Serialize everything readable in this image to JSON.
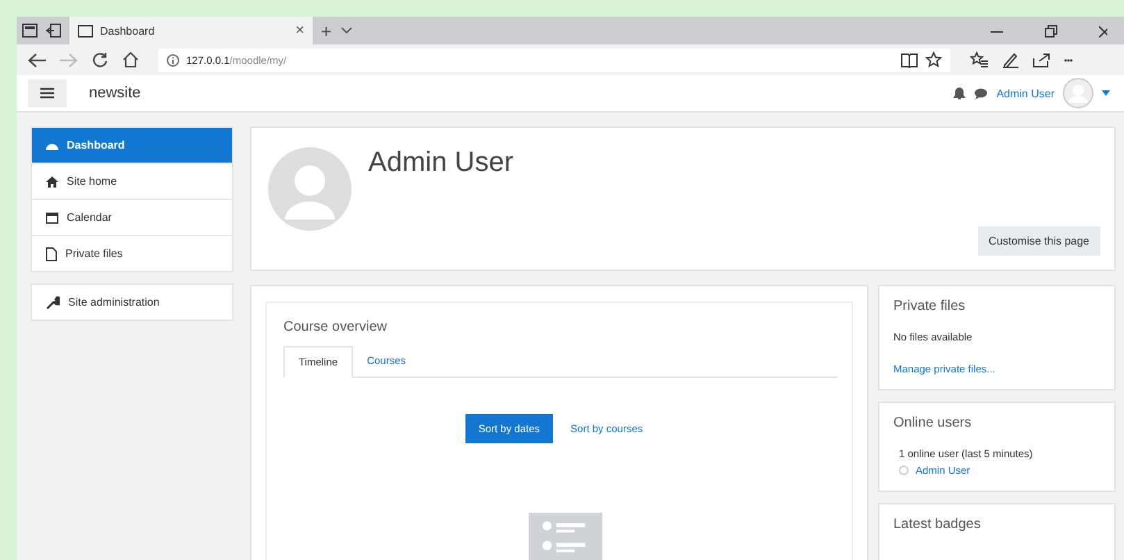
{
  "browser": {
    "tab_title": "Dashboard",
    "close": "×",
    "new_tab": "+",
    "address": "127.0.0.1",
    "address_path": "/moodle/my/"
  },
  "navbar": {
    "site_name": "newsite",
    "user_name": "Admin User"
  },
  "sidebar": {
    "items": [
      {
        "label": "Dashboard",
        "kind": "gauge",
        "selected": true
      },
      {
        "label": "Site home",
        "kind": "home",
        "selected": false
      },
      {
        "label": "Calendar",
        "kind": "calendar",
        "selected": false
      },
      {
        "label": "Private files",
        "kind": "file",
        "selected": false
      }
    ],
    "admin": {
      "label": "Site administration"
    }
  },
  "header": {
    "user_name": "Admin User",
    "button": "Customise this page"
  },
  "course_overview": {
    "title": "Course overview",
    "tabs": [
      {
        "label": "Timeline",
        "selected": true
      },
      {
        "label": "Courses",
        "selected": false
      }
    ],
    "sort": [
      {
        "label": "Sort by dates",
        "selected": true
      },
      {
        "label": "Sort by courses",
        "selected": false
      }
    ]
  },
  "blocks": [
    {
      "kind": "files",
      "title": "Private files",
      "text": "No files available",
      "link": "Manage private files..."
    },
    {
      "kind": "users",
      "title": "Online users",
      "text": "1 online user (last 5 minutes)",
      "link": "Admin User"
    },
    {
      "kind": "badges",
      "title": "Latest badges"
    }
  ]
}
